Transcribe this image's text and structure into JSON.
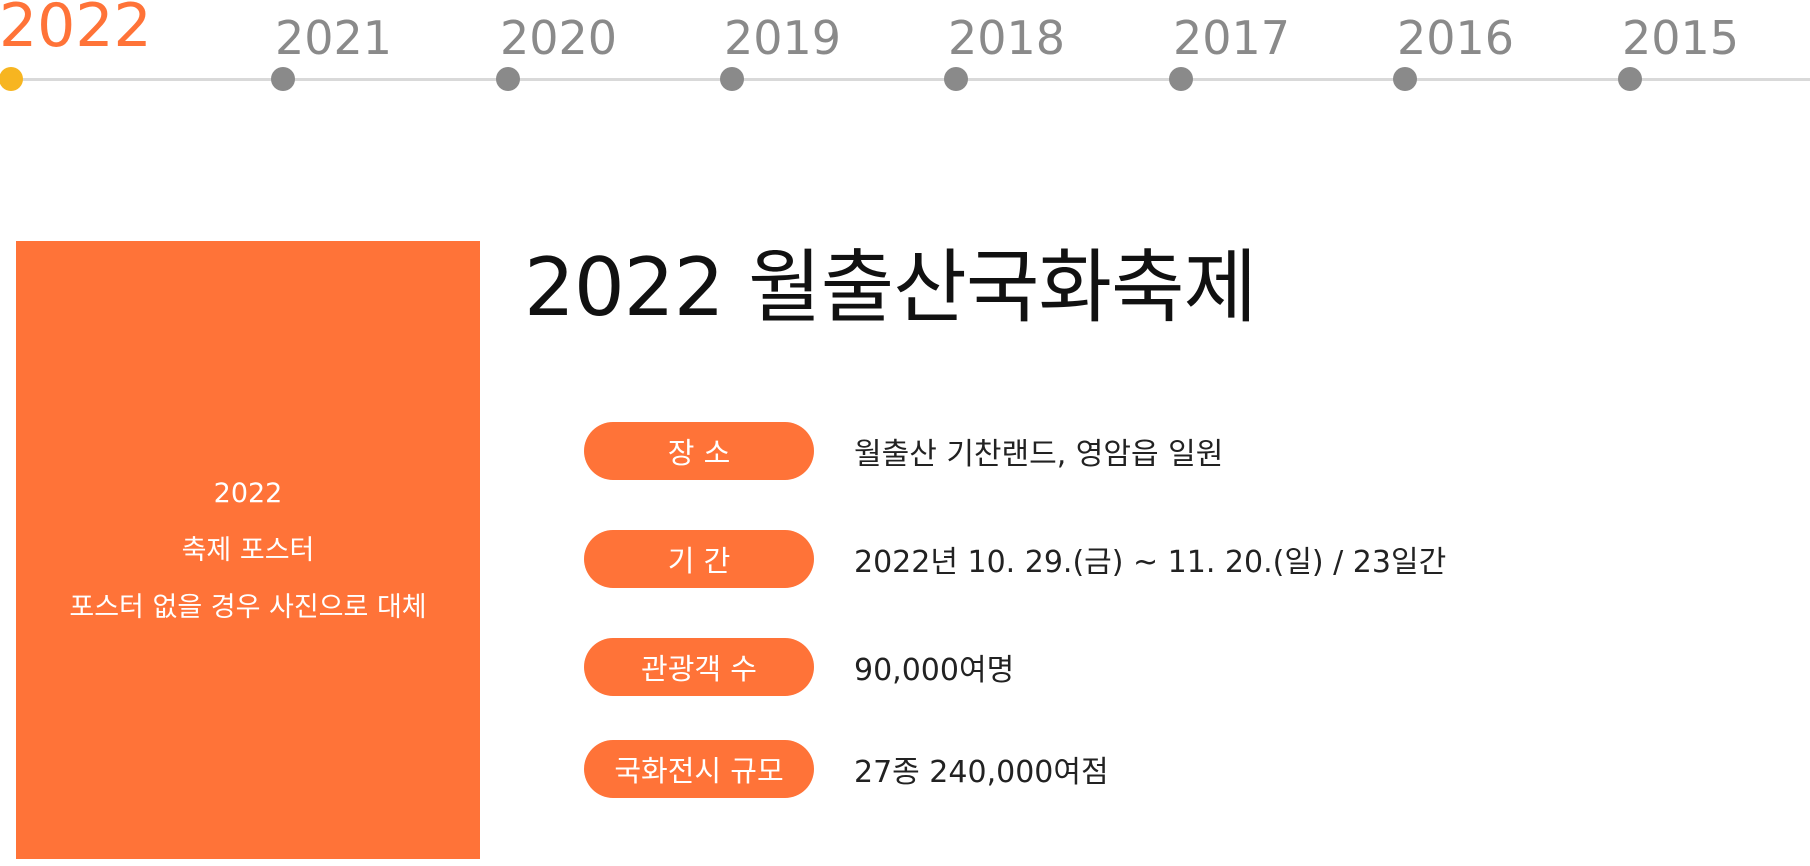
{
  "timeline": {
    "years": [
      {
        "label": "2022",
        "active": true
      },
      {
        "label": "2021",
        "active": false
      },
      {
        "label": "2020",
        "active": false
      },
      {
        "label": "2019",
        "active": false
      },
      {
        "label": "2018",
        "active": false
      },
      {
        "label": "2017",
        "active": false
      },
      {
        "label": "2016",
        "active": false
      },
      {
        "label": "2015",
        "active": false
      }
    ]
  },
  "poster": {
    "year": "2022",
    "caption": "축제 포스터",
    "note": "포스터 없을 경우 사진으로 대체"
  },
  "festival": {
    "title": "2022 월출산국화축제",
    "info": [
      {
        "label": "장 소",
        "value": "월출산 기찬랜드, 영암읍 일원"
      },
      {
        "label": "기 간",
        "value": "2022년 10. 29.(금) ~ 11. 20.(일) / 23일간"
      },
      {
        "label": "관광객 수",
        "value": "90,000여명"
      },
      {
        "label": "국화전시 규모",
        "value": "27종 240,000여점"
      }
    ]
  },
  "colors": {
    "accent": "#ff7338",
    "active_dot": "#f7b520",
    "inactive": "#8a8a8a"
  }
}
